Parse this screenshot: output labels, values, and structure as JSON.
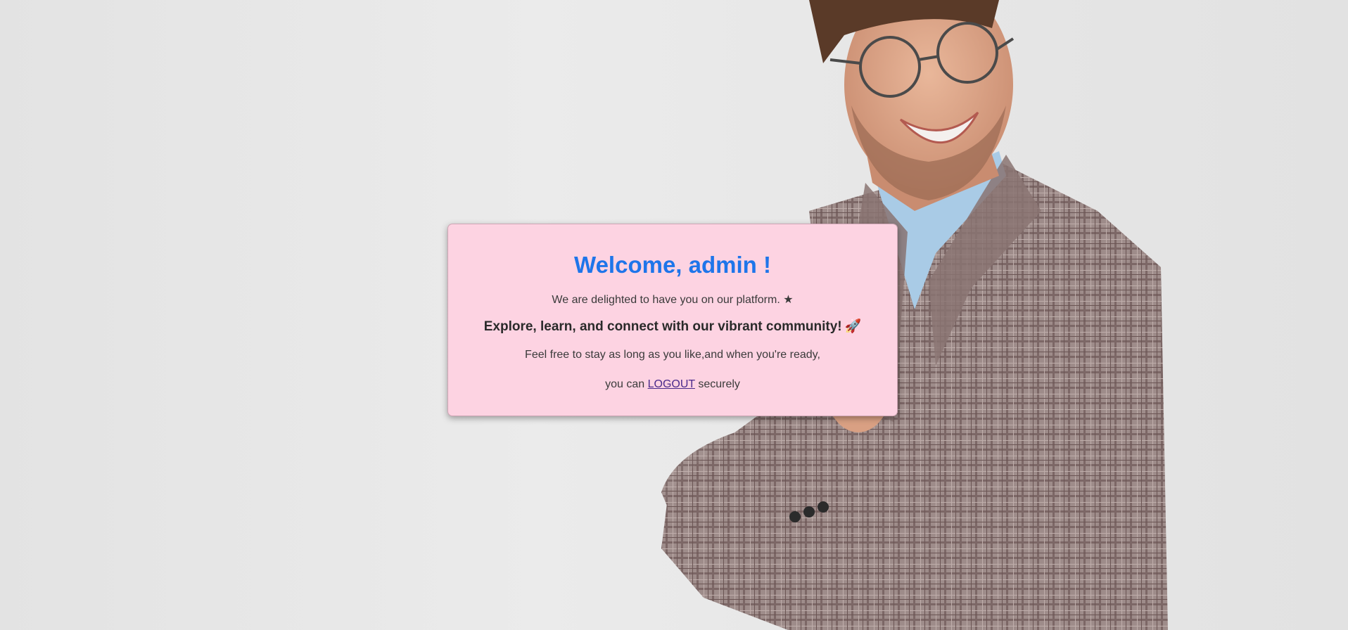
{
  "welcome": {
    "title": "Welcome, admin !",
    "delighted_text": "We are delighted to have you on our platform. ★",
    "explore_text": "Explore, learn, and connect with our vibrant community!",
    "rocket_emoji": "🚀",
    "stay_text": "Feel free to stay as long as you like,and when you're ready,",
    "logout_prefix": "you can",
    "logout_link": "LOGOUT",
    "logout_suffix": "securely"
  },
  "colors": {
    "card_background": "#fdd3e2",
    "title_color": "#1e75ea",
    "link_color": "#4b2a8c",
    "page_background": "#e8e8e8"
  }
}
